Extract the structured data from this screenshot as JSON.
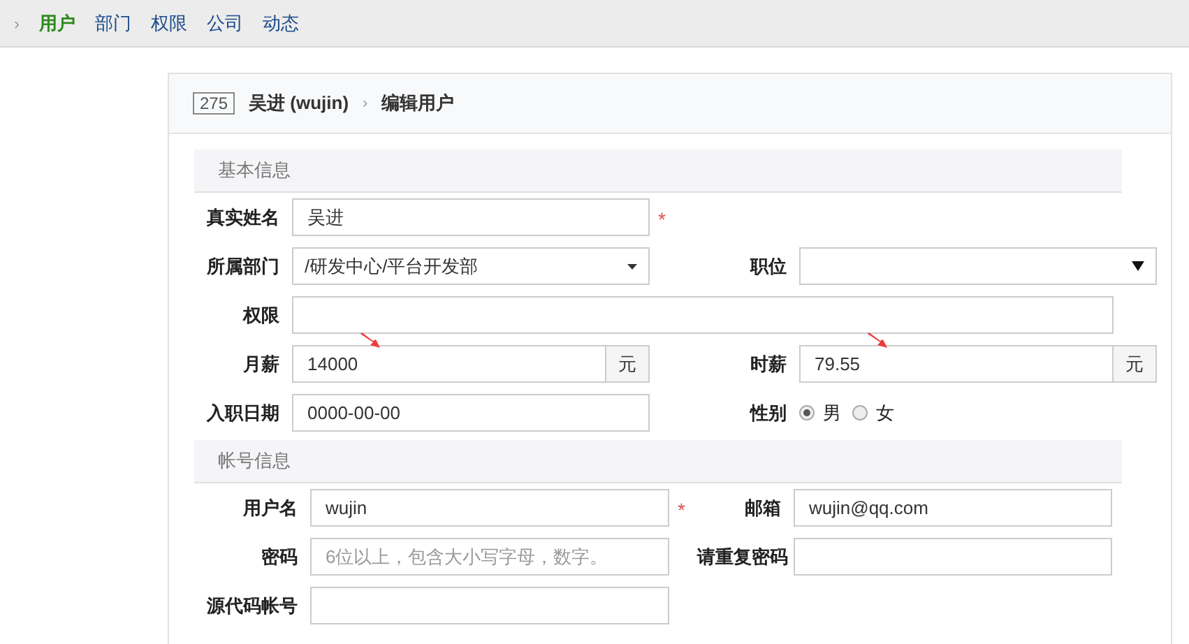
{
  "nav": {
    "separator": "›",
    "items": [
      {
        "label": "用户",
        "selected": true
      },
      {
        "label": "部门",
        "selected": false
      },
      {
        "label": "权限",
        "selected": false
      },
      {
        "label": "公司",
        "selected": false
      },
      {
        "label": "动态",
        "selected": false
      }
    ]
  },
  "header": {
    "id": "275",
    "name": "吴进 (wujin)",
    "separator": "›",
    "title": "编辑用户"
  },
  "sections": [
    {
      "title": "基本信息",
      "kind": "basic",
      "rows": [
        {
          "fields": [
            {
              "label": "真实姓名",
              "kind": "text",
              "value": "吴进",
              "required": "*"
            }
          ]
        },
        {
          "fields": [
            {
              "label": "所属部门",
              "kind": "select",
              "value": "/研发中心/平台开发部"
            },
            {
              "label": "职位",
              "kind": "select-large"
            }
          ]
        },
        {
          "fields": [
            {
              "label": "权限",
              "kind": "wide"
            }
          ]
        },
        {
          "fields": [
            {
              "label": "月薪",
              "kind": "addon",
              "value": "14000",
              "unit": "元",
              "marked": true
            },
            {
              "label": "时薪",
              "kind": "addon",
              "value": "79.55",
              "unit": "元",
              "marked": true
            }
          ]
        },
        {
          "fields": [
            {
              "label": "入职日期",
              "kind": "text",
              "value": "0000-00-00"
            },
            {
              "label": "性别",
              "kind": "radio",
              "options": [
                {
                  "label": "男",
                  "selected": true
                },
                {
                  "label": "女",
                  "selected": false
                }
              ]
            }
          ]
        }
      ]
    },
    {
      "title": "帐号信息",
      "kind": "account",
      "rows": [
        {
          "fields": [
            {
              "label": "用户名",
              "kind": "text",
              "value": "wujin",
              "required": "*"
            },
            {
              "label": "邮箱",
              "kind": "text",
              "value": "wujin@qq.com"
            }
          ]
        },
        {
          "fields": [
            {
              "label": "密码",
              "kind": "text",
              "placeholder": "6位以上，包含大小写字母，数字。"
            },
            {
              "label": "请重复密码",
              "kind": "text"
            }
          ]
        },
        {
          "fields": [
            {
              "label": "源代码帐号",
              "kind": "text"
            }
          ]
        }
      ]
    }
  ]
}
